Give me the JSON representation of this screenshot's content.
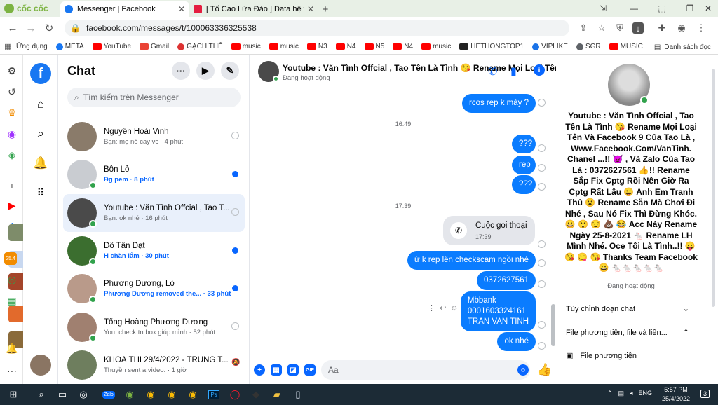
{
  "browser": {
    "brand": "cốc cốc",
    "tabs": [
      {
        "title": "Messenger | Facebook",
        "color": "#1877f2"
      },
      {
        "title": "[ Tố Cáo Lừa Đảo ] Data hệ th",
        "color": "#e41e3f"
      }
    ],
    "url": "facebook.com/messages/t/100063336325538",
    "bookmarks": [
      {
        "label": "Ứng dụng",
        "color": "#555"
      },
      {
        "label": "META",
        "color": "#1877f2"
      },
      {
        "label": "YouTube",
        "color": "#f00"
      },
      {
        "label": "Gmail",
        "color": "#ea4335"
      },
      {
        "label": "GẠCH THẺ",
        "color": "#d33"
      },
      {
        "label": "music",
        "color": "#f00"
      },
      {
        "label": "music",
        "color": "#f00"
      },
      {
        "label": "N3",
        "color": "#f00"
      },
      {
        "label": "N4",
        "color": "#f00"
      },
      {
        "label": "N5",
        "color": "#f00"
      },
      {
        "label": "N4",
        "color": "#f00"
      },
      {
        "label": "music",
        "color": "#f00"
      },
      {
        "label": "HETHONGTOP1",
        "color": "#222"
      },
      {
        "label": "VIPLIKE",
        "color": "#1a73e8"
      },
      {
        "label": "SGR",
        "color": "#5f6368"
      },
      {
        "label": "MUSIC",
        "color": "#f00"
      }
    ],
    "bookmarks_right": "Danh sách đọc"
  },
  "chats": {
    "title": "Chat",
    "search_placeholder": "Tìm kiếm trên Messenger",
    "items": [
      {
        "name": "Nguyễn Hoài Vinh",
        "preview": "Bạn: mẹ nó cay vc · 4 phút",
        "status": "seen",
        "online": false,
        "unread": false,
        "avatar": "#8a7b6a"
      },
      {
        "name": "Bôn Lỏ",
        "preview": "Đg pem · 8 phút",
        "status": "dot",
        "online": true,
        "unread": true,
        "avatar": "#c9ccd1"
      },
      {
        "name": "Youtube : Văn Tình Offcial , Tao T...",
        "preview": "Bạn: ok nhé · 16 phút",
        "status": "seen",
        "online": true,
        "unread": false,
        "avatar": "#4a4a4a"
      },
      {
        "name": "Đỗ Tấn Đạt",
        "preview": "H chăn lắm · 30 phút",
        "status": "dot",
        "online": true,
        "unread": true,
        "avatar": "#3b6e2f"
      },
      {
        "name": "Phương Dương, Lỏ",
        "preview": "Phương Dương removed the... · 33 phút",
        "status": "dot",
        "online": true,
        "unread": true,
        "avatar": "#b99a8a"
      },
      {
        "name": "Tống Hoàng Phương Dương",
        "preview": "You: check tn box giúp mình · 52 phút",
        "status": "seen",
        "online": true,
        "unread": false,
        "avatar": "#a08070"
      },
      {
        "name": "KHOÁ THI 29/4/2022 - TRUNG T...",
        "preview": "Thuyền sent a video. · 1 giờ",
        "status": "muted",
        "online": false,
        "unread": false,
        "avatar": "#6e7e5e"
      }
    ]
  },
  "conversation": {
    "name": "Youtube : Văn Tình Offcial , Tao Tên Là Tình 😘 Rename Mọi Loại Tên",
    "status": "Đang hoạt động",
    "messages": [
      {
        "text": "rcos  rep k mày ?"
      },
      {
        "time": "16:49"
      },
      {
        "text": "???"
      },
      {
        "text": "rep"
      },
      {
        "text": "???"
      },
      {
        "time": "17:39"
      },
      {
        "text": "ừ k rep lên checkscam ngồi nhé"
      },
      {
        "text": "0372627561"
      },
      {
        "text": "Mbbank\n0001603324161\nTRAN VAN TINH"
      },
      {
        "text": "ok nhé"
      }
    ],
    "call": {
      "title": "Cuộc gọi thoại",
      "time": "17:39"
    },
    "input_placeholder": "Aa"
  },
  "info": {
    "name": "Youtube : Văn Tình Offcial , Tao Tên Là Tình 😘 Rename Mọi Loại Tên Và Facebook 9 Của Tao Là , Www.Facebook.Com/VanTinh. Chanel ...!! 😈 , Và Zalo Của Tao Là : 0372627561 👍!! Rename Sắp Fix Cptg Rồi Nên Giờ Ra Cptg Rất Lâu 😀 Anh Em Tranh Thủ 😮 Rename Sẵn Mà Chơi Đi Nhé , Sau Nó Fix Thì Đừng Khóc. 😀 😲 😏 💩 😂 Acc Này Rename Ngày 25-8-2021 🐁 Rename LH Mình Nhé. Oce Tôi Là Tình..!! 😛 😘 😋 😘 Thanks Team Facebook 😀 🐁🐁🐁🐁🐁",
    "status": "Đang hoạt động",
    "sections": [
      "Tùy chỉnh đoạn chat",
      "File phương tiện, file và liên...",
      "File phương tiện"
    ]
  },
  "taskbar": {
    "time": "5:57 PM",
    "date": "25/4/2022",
    "lang": "ENG",
    "notif": "3"
  }
}
